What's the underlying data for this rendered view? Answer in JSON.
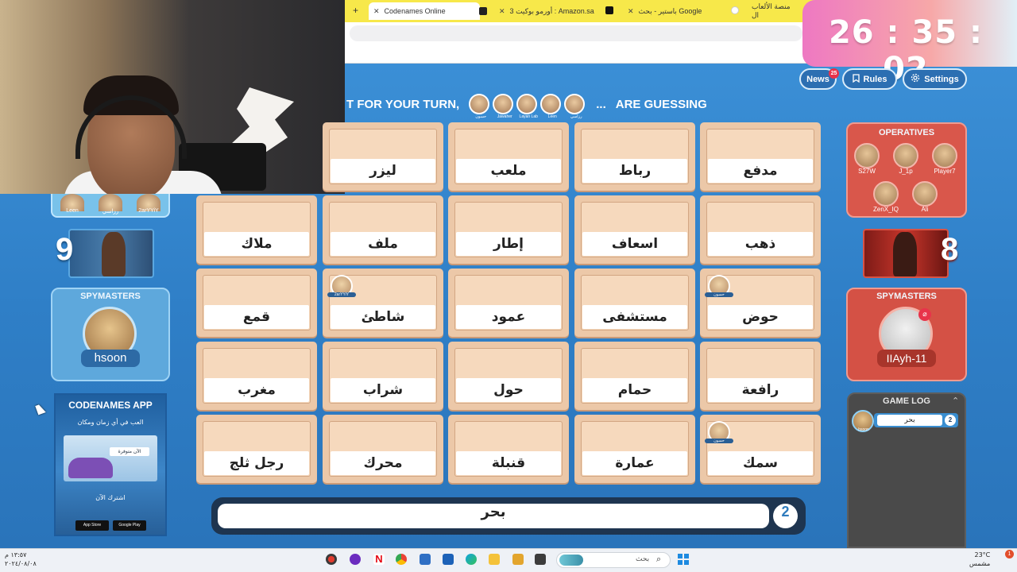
{
  "browser": {
    "new_tab": "+",
    "tabs": [
      {
        "label": "Codenames Online",
        "active": true,
        "close": "✕"
      },
      {
        "label": "أورمو بوكيت 3 : Amazon.sa",
        "active": false,
        "close": "✕"
      },
      {
        "label": "باستير - بحث Google",
        "active": false,
        "close": "✕"
      },
      {
        "label": "منصة الألعاب ال",
        "active": false,
        "close": ""
      }
    ]
  },
  "timer": "26 : 35 : 02",
  "top_buttons": {
    "news": "News",
    "news_count": "25",
    "rules": "Rules",
    "settings": "Settings"
  },
  "banner": {
    "prefix": "T FOR YOUR TURN,",
    "players": [
      "حسون",
      "Jawaher",
      "Layan Lab",
      "Leen",
      "رزاسي"
    ],
    "ellipsis": "...",
    "suffix": "ARE GUESSING"
  },
  "board": {
    "rows": [
      [
        "ليزر",
        "ملعب",
        "رباط",
        "مدفع"
      ],
      [
        "ملاك",
        "ملف",
        "إطار",
        "اسعاف",
        "ذهب"
      ],
      [
        "قمع",
        "شاطئ",
        "عمود",
        "مستشفى",
        "حوض"
      ],
      [
        "مغرب",
        "شراب",
        "حول",
        "حمام",
        "رافعة"
      ],
      [
        "رجل ثلج",
        "محرك",
        "قنبلة",
        "عمارة",
        "سمك"
      ]
    ],
    "markers": {
      "shati": "2arYYiY",
      "hawd": "حسون",
      "samak": "حسون"
    }
  },
  "blue_team": {
    "operatives": [
      {
        "name": "Leen"
      },
      {
        "name": "رزاسي"
      },
      {
        "name": "2arYYiY"
      }
    ],
    "score": "9",
    "spymasters_title": "SPYMASTERS",
    "spymaster": "hsoon"
  },
  "red_team": {
    "operatives_title": "OPERATIVES",
    "operatives": [
      {
        "name": "S27W"
      },
      {
        "name": "J_1p"
      },
      {
        "name": "Player7"
      },
      {
        "name": "ZenX_IQ"
      },
      {
        "name": "Ali"
      }
    ],
    "score": "8",
    "spymasters_title": "SPYMASTERS",
    "spymaster": "IIAyh-11"
  },
  "game_log": {
    "title": "GAME LOG",
    "entries": [
      {
        "player": "hsoon",
        "word": "بحر",
        "number": "2"
      }
    ]
  },
  "clue": {
    "word": "بحر",
    "number": "2"
  },
  "ad": {
    "title": "CODENAMES APP",
    "subtitle": "العب في أي زمان ومكان",
    "pill": "الآن متوفرة",
    "download": "اشترك الآن",
    "app_store": "App Store",
    "google_play": "Google Play"
  },
  "taskbar": {
    "search_label": "بحث",
    "clock": [
      "١٣:٥٧ م",
      "٢٠٢٤/٠٨/٠٨"
    ],
    "weather": [
      "23°C",
      "مشمس"
    ],
    "notification_count": "1"
  },
  "colors": {
    "blue_team": "#5ea8dc",
    "red_team": "#d45145",
    "card": "#ecc8a8",
    "timer_start": "#ee78c2"
  }
}
